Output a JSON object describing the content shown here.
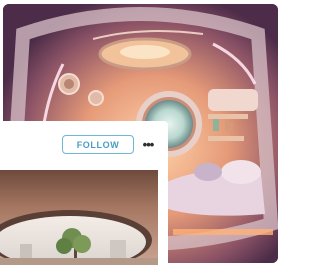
{
  "post": {
    "follow_label": "FOLLOW",
    "more_label": "•••"
  },
  "images": {
    "hero": "pod-interior-image",
    "thumbnail": "pod-window-image"
  },
  "colors": {
    "follow_accent": "#6fb7d2",
    "follow_text": "#4a9fc0"
  }
}
